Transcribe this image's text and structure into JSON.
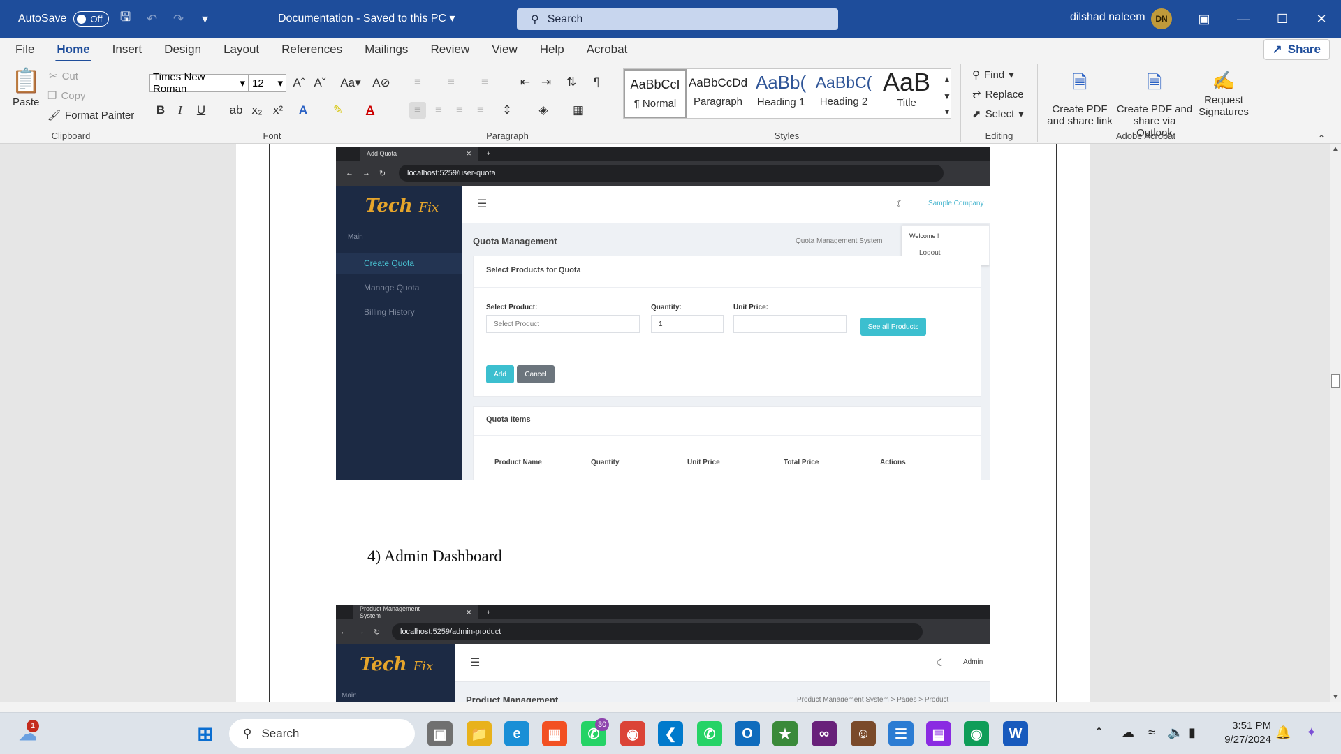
{
  "titlebar": {
    "autosave_label": "AutoSave",
    "autosave_state": "Off",
    "doc_title": "Documentation - Saved to this PC",
    "search_placeholder": "Search",
    "user_name": "dilshad naleem",
    "user_initials": "DN"
  },
  "menu": {
    "tabs": [
      "File",
      "Home",
      "Insert",
      "Design",
      "Layout",
      "References",
      "Mailings",
      "Review",
      "View",
      "Help",
      "Acrobat"
    ],
    "active": "Home",
    "share_label": "Share"
  },
  "ribbon": {
    "clipboard": {
      "paste": "Paste",
      "cut": "Cut",
      "copy": "Copy",
      "format_painter": "Format Painter",
      "label": "Clipboard"
    },
    "font": {
      "family": "Times New Roman",
      "size": "12",
      "label": "Font"
    },
    "paragraph": {
      "label": "Paragraph"
    },
    "styles": {
      "items": [
        {
          "sample": "AaBbCcI",
          "name": "¶ Normal"
        },
        {
          "sample": "AaBbCcDd",
          "name": "Paragraph"
        },
        {
          "sample": "AaBb(",
          "name": "Heading 1"
        },
        {
          "sample": "AaBbC(",
          "name": "Heading 2"
        },
        {
          "sample": "AaB",
          "name": "Title"
        }
      ],
      "label": "Styles"
    },
    "editing": {
      "find": "Find",
      "replace": "Replace",
      "select": "Select",
      "label": "Editing"
    },
    "acrobat": {
      "create_pdf_link": "Create PDF and share link",
      "create_pdf_outlook": "Create PDF and share via Outlook",
      "request_signatures": "Request Signatures",
      "label": "Adobe Acrobat"
    }
  },
  "shot1": {
    "tab_title": "Add Quota",
    "url": "localhost:5259/user-quota",
    "logo_main": "Tech",
    "logo_sub": "Fix",
    "sidebar_section": "Main",
    "sidebar_items": [
      "Create Quota",
      "Manage Quota",
      "Billing History"
    ],
    "company": "Sample Company",
    "dropdown_welcome": "Welcome !",
    "dropdown_logout": "Logout",
    "page_title": "Quota Management",
    "breadcrumb": "Quota Management System",
    "card_title": "Select Products for Quota",
    "select_product_label": "Select Product:",
    "select_product_placeholder": "Select Product",
    "quantity_label": "Quantity:",
    "quantity_value": "1",
    "unit_price_label": "Unit Price:",
    "see_all_button": "See all Products",
    "add_button": "Add",
    "cancel_button": "Cancel",
    "items_title": "Quota Items",
    "columns": [
      "Product Name",
      "Quantity",
      "Unit Price",
      "Total Price",
      "Actions"
    ]
  },
  "doc": {
    "heading": "4)   Admin Dashboard"
  },
  "shot2": {
    "tab_title": "Product Management System",
    "url": "localhost:5259/admin-product",
    "logo_main": "Tech",
    "logo_sub": "Fix",
    "sidebar_section": "Main",
    "user": "Admin",
    "page_title": "Product Management",
    "breadcrumb": "Product Management System  >  Pages  >  Product"
  },
  "taskbar": {
    "search": "Search",
    "time": "3:51 PM",
    "date": "9/27/2024",
    "whatsapp_badge": "30",
    "notification_badge": "1"
  }
}
